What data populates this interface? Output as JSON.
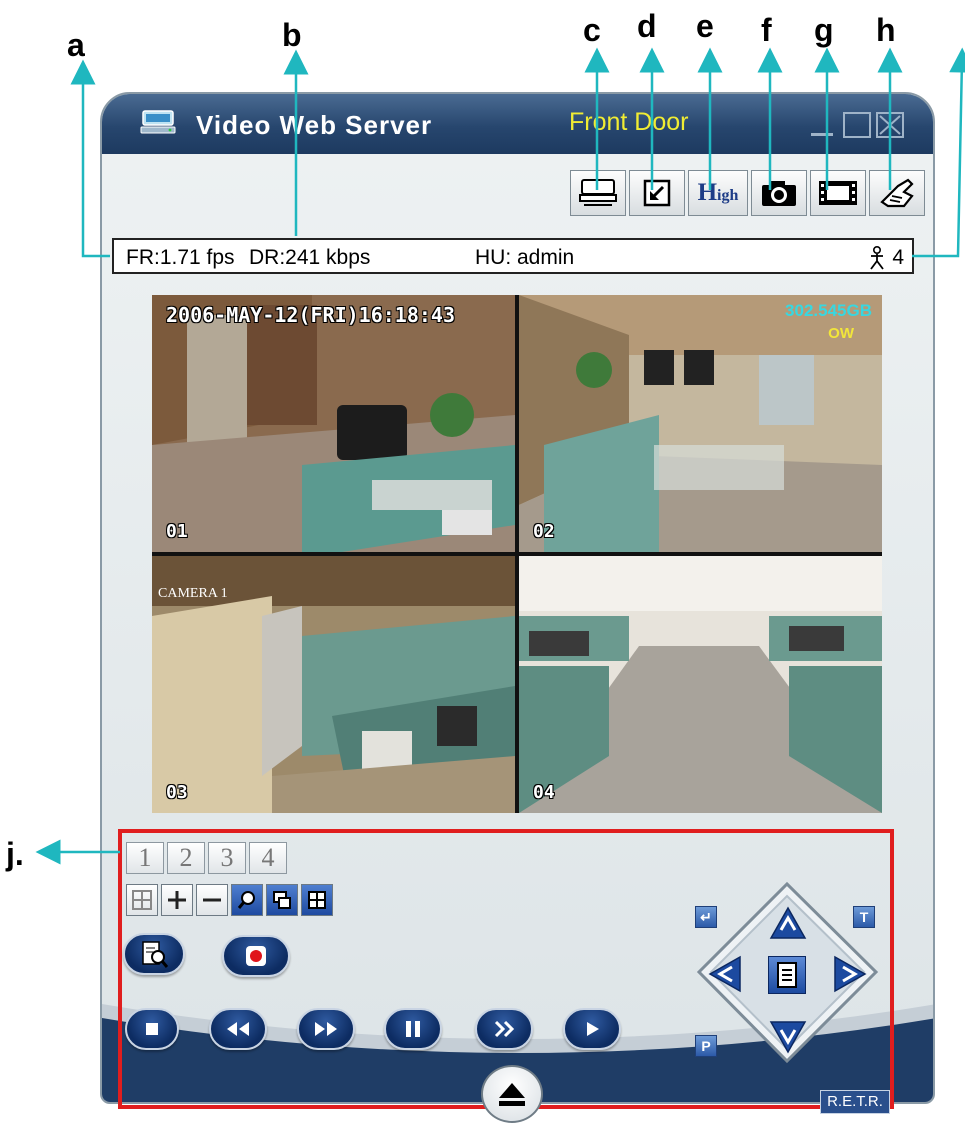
{
  "callouts": {
    "a": "a",
    "b": "b",
    "c": "c",
    "d": "d",
    "e": "e",
    "f": "f",
    "g": "g",
    "h": "h",
    "j": "j."
  },
  "window": {
    "app_title": "Video Web Server",
    "camera_title": "Front Door",
    "colors": {
      "titlebar": "#27466e",
      "camera_title": "#f0ec33",
      "body": "#e6ecee",
      "callout_arrow": "#1fb7bf",
      "highlight_border": "#e01e1e"
    }
  },
  "toolbar": {
    "buttons": [
      {
        "name": "network-icon"
      },
      {
        "name": "minimize-view-icon"
      },
      {
        "name": "quality-button",
        "label_cap": "H",
        "label_rest": "igh"
      },
      {
        "name": "snapshot-icon"
      },
      {
        "name": "record-film-icon"
      },
      {
        "name": "settings-hand-icon"
      }
    ]
  },
  "status": {
    "frame_rate": "FR:1.71 fps",
    "data_rate": "DR:241 kbps",
    "user": "HU: admin",
    "online_users": "4"
  },
  "video": {
    "timestamp": "2006-MAY-12(FRI)16:18:43",
    "disk_space": "302.545GB",
    "overwrite": "OW",
    "channels": [
      "01",
      "02",
      "03",
      "04"
    ],
    "camera3_label": "CAMERA 1"
  },
  "controls": {
    "channel_tabs": [
      "1",
      "2",
      "3",
      "4"
    ],
    "view_buttons": [
      "quad-view-icon",
      "zoom-in-icon",
      "zoom-out-icon",
      "search-zoom-icon",
      "pip-icon",
      "grid-view-icon"
    ],
    "ptz_side_labels": {
      "enter": "↵",
      "tele": "T",
      "preset": "P"
    },
    "retr_label": "R.E.T.R."
  }
}
